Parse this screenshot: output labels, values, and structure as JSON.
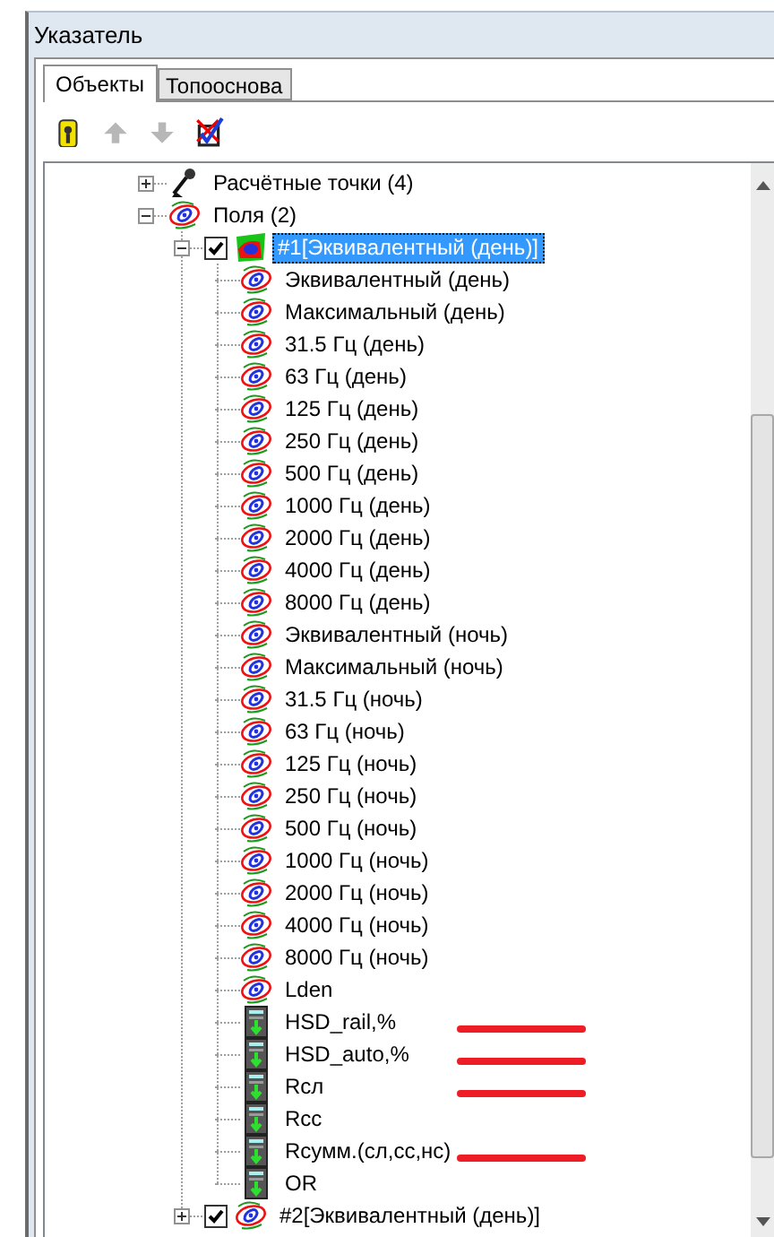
{
  "window": {
    "title": "Указатель"
  },
  "tabs": [
    {
      "label": "Объекты",
      "selected": true
    },
    {
      "label": "Топооснова",
      "selected": false
    }
  ],
  "toolbar": [
    {
      "kind": "key",
      "disabled": false
    },
    {
      "kind": "up",
      "disabled": true
    },
    {
      "kind": "down",
      "disabled": true
    },
    {
      "kind": "check",
      "disabled": false
    }
  ],
  "tree": [
    {
      "label": "Расчётные точки (4)",
      "kind": "points",
      "expanded": false,
      "selected": false
    },
    {
      "label": "Поля (2)",
      "kind": "field",
      "expanded": true,
      "selected": false,
      "children": [
        {
          "label": "#1[Эквивалентный (день)]",
          "kind": "result",
          "expanded": true,
          "checked": true,
          "selected": true,
          "children": [
            {
              "label": "Эквивалентный (день)",
              "kind": "field",
              "selected": false,
              "marked": false
            },
            {
              "label": "Максимальный (день)",
              "kind": "field",
              "selected": false,
              "marked": false
            },
            {
              "label": "31.5 Гц (день)",
              "kind": "field",
              "selected": false,
              "marked": false
            },
            {
              "label": "63 Гц (день)",
              "kind": "field",
              "selected": false,
              "marked": false
            },
            {
              "label": "125 Гц (день)",
              "kind": "field",
              "selected": false,
              "marked": false
            },
            {
              "label": "250 Гц (день)",
              "kind": "field",
              "selected": false,
              "marked": false
            },
            {
              "label": "500 Гц (день)",
              "kind": "field",
              "selected": false,
              "marked": false
            },
            {
              "label": "1000 Гц (день)",
              "kind": "field",
              "selected": false,
              "marked": false
            },
            {
              "label": "2000 Гц (день)",
              "kind": "field",
              "selected": false,
              "marked": false
            },
            {
              "label": "4000 Гц (день)",
              "kind": "field",
              "selected": false,
              "marked": false
            },
            {
              "label": "8000 Гц (день)",
              "kind": "field",
              "selected": false,
              "marked": false
            },
            {
              "label": "Эквивалентный (ночь)",
              "kind": "field",
              "selected": false,
              "marked": false
            },
            {
              "label": "Максимальный (ночь)",
              "kind": "field",
              "selected": false,
              "marked": false
            },
            {
              "label": "31.5 Гц (ночь)",
              "kind": "field",
              "selected": false,
              "marked": false
            },
            {
              "label": "63 Гц (ночь)",
              "kind": "field",
              "selected": false,
              "marked": false
            },
            {
              "label": "125 Гц (ночь)",
              "kind": "field",
              "selected": false,
              "marked": false
            },
            {
              "label": "250 Гц (ночь)",
              "kind": "field",
              "selected": false,
              "marked": false
            },
            {
              "label": "500 Гц (ночь)",
              "kind": "field",
              "selected": false,
              "marked": false
            },
            {
              "label": "1000 Гц (ночь)",
              "kind": "field",
              "selected": false,
              "marked": false
            },
            {
              "label": "2000 Гц (ночь)",
              "kind": "field",
              "selected": false,
              "marked": false
            },
            {
              "label": "4000 Гц (ночь)",
              "kind": "field",
              "selected": false,
              "marked": false
            },
            {
              "label": "8000 Гц (ночь)",
              "kind": "field",
              "selected": false,
              "marked": false
            },
            {
              "label": "Lden",
              "kind": "field",
              "selected": false,
              "marked": false
            },
            {
              "label": "HSD_rail,%",
              "kind": "grid",
              "selected": false,
              "marked": true
            },
            {
              "label": "HSD_auto,%",
              "kind": "grid",
              "selected": false,
              "marked": true
            },
            {
              "label": "Rсл",
              "kind": "grid",
              "selected": false,
              "marked": true
            },
            {
              "label": "Rсс",
              "kind": "grid",
              "selected": false,
              "marked": false
            },
            {
              "label": "Rсумм.(сл,сс,нс)",
              "kind": "grid",
              "selected": false,
              "marked": true
            },
            {
              "label": "OR",
              "kind": "grid",
              "selected": false,
              "marked": false
            }
          ]
        },
        {
          "label": "#2[Эквивалентный (день)]",
          "kind": "field",
          "expanded": false,
          "checked": true,
          "selected": false
        }
      ]
    }
  ]
}
